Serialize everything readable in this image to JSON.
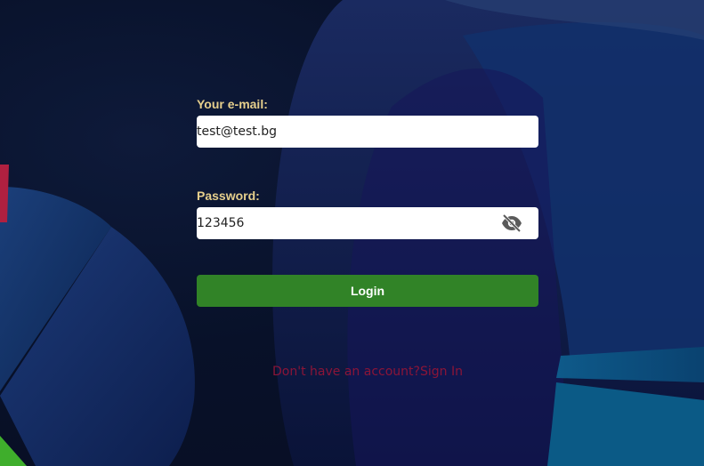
{
  "login_form": {
    "email_label": "Your e-mail:",
    "email_value": "test@test.bg",
    "password_label": "Password:",
    "password_value": "123456",
    "password_toggle_icon": "eye-off-icon",
    "login_button_label": "Login",
    "signup_prompt": "Don't have an account?",
    "signup_link": "Sign In"
  },
  "colors": {
    "label": "#e6cf8c",
    "login_button": "#318327",
    "signup_text": "#8b1538",
    "background": "#081129"
  }
}
